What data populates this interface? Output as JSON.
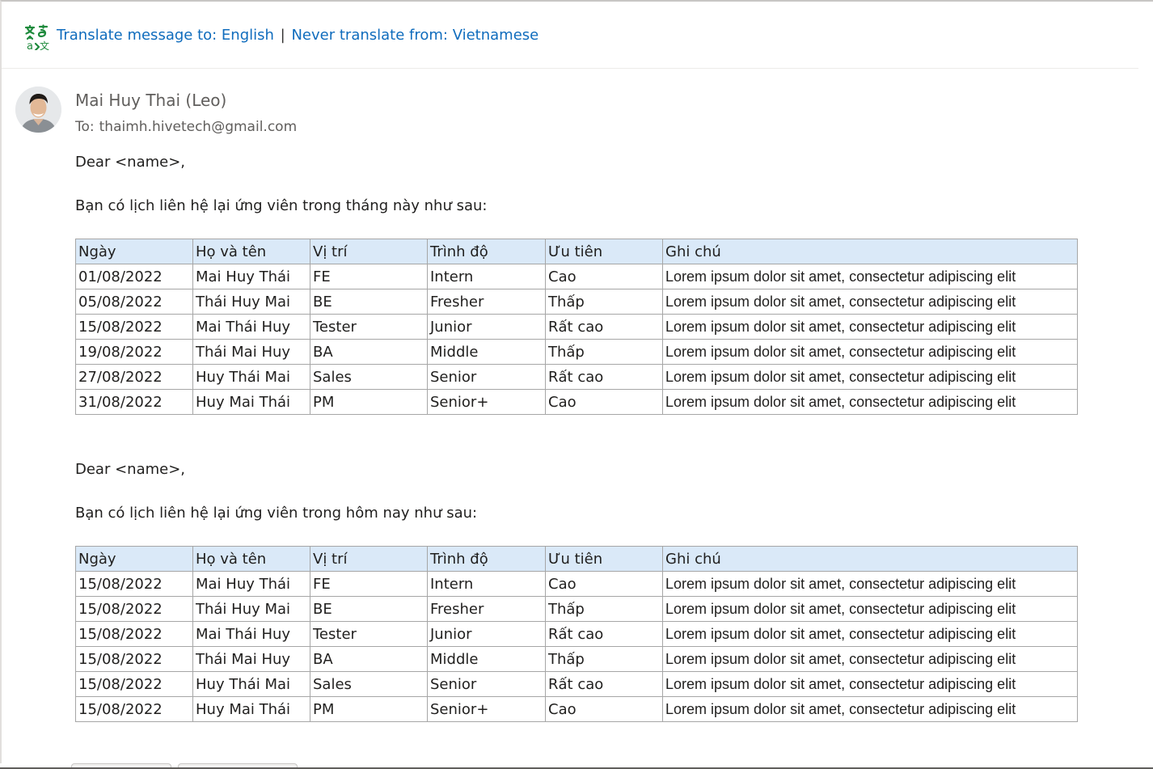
{
  "translate_bar": {
    "translate_to": "Translate message to: English",
    "separator": "|",
    "never_translate": "Never translate from: Vietnamese"
  },
  "sender": {
    "name": "Mai Huy Thai (Leo)",
    "to_label": "To:",
    "to_address": "thaimh.hivetech@gmail.com"
  },
  "message": {
    "greeting_1": "Dear <name>,",
    "intro_1": "Bạn có lịch liên hệ lại ứng viên trong tháng này như sau:",
    "greeting_2": "Dear <name>,",
    "intro_2": "Bạn có lịch liên hệ lại ứng viên trong hôm nay như sau:"
  },
  "table_headers": [
    "Ngày",
    "Họ và tên",
    "Vị trí",
    "Trình độ",
    "Ưu tiên",
    "Ghi chú"
  ],
  "table_month": [
    [
      "01/08/2022",
      "Mai Huy Thái",
      "FE",
      "Intern",
      "Cao",
      "Lorem ipsum dolor sit amet, consectetur adipiscing elit"
    ],
    [
      "05/08/2022",
      "Thái Huy Mai",
      "BE",
      "Fresher",
      "Thấp",
      "Lorem ipsum dolor sit amet, consectetur adipiscing elit"
    ],
    [
      "15/08/2022",
      "Mai Thái Huy",
      "Tester",
      "Junior",
      "Rất cao",
      "Lorem ipsum dolor sit amet, consectetur adipiscing elit"
    ],
    [
      "19/08/2022",
      "Thái Mai Huy",
      "BA",
      "Middle",
      "Thấp",
      "Lorem ipsum dolor sit amet, consectetur adipiscing elit"
    ],
    [
      "27/08/2022",
      "Huy Thái Mai",
      "Sales",
      "Senior",
      "Rất cao",
      "Lorem ipsum dolor sit amet, consectetur adipiscing elit"
    ],
    [
      "31/08/2022",
      "Huy Mai Thái",
      "PM",
      "Senior+",
      "Cao",
      "Lorem ipsum dolor sit amet, consectetur adipiscing elit"
    ]
  ],
  "table_today": [
    [
      "15/08/2022",
      "Mai Huy Thái",
      "FE",
      "Intern",
      "Cao",
      "Lorem ipsum dolor sit amet, consectetur adipiscing elit"
    ],
    [
      "15/08/2022",
      "Thái Huy Mai",
      "BE",
      "Fresher",
      "Thấp",
      "Lorem ipsum dolor sit amet, consectetur adipiscing elit"
    ],
    [
      "15/08/2022",
      "Mai Thái Huy",
      "Tester",
      "Junior",
      "Rất cao",
      "Lorem ipsum dolor sit amet, consectetur adipiscing elit"
    ],
    [
      "15/08/2022",
      "Thái Mai Huy",
      "BA",
      "Middle",
      "Thấp",
      "Lorem ipsum dolor sit amet, consectetur adipiscing elit"
    ],
    [
      "15/08/2022",
      "Huy Thái Mai",
      "Sales",
      "Senior",
      "Rất cao",
      "Lorem ipsum dolor sit amet, consectetur adipiscing elit"
    ],
    [
      "15/08/2022",
      "Huy Mai Thái",
      "PM",
      "Senior+",
      "Cao",
      "Lorem ipsum dolor sit amet, consectetur adipiscing elit"
    ]
  ],
  "icons": {
    "translate": "translate-icon",
    "avatar": "avatar-photo"
  },
  "colors": {
    "link": "#0f6cbd",
    "translate_icon": "#1e8a3c",
    "table_header_bg": "#dae9f8",
    "table_border": "#a6a6a6"
  }
}
